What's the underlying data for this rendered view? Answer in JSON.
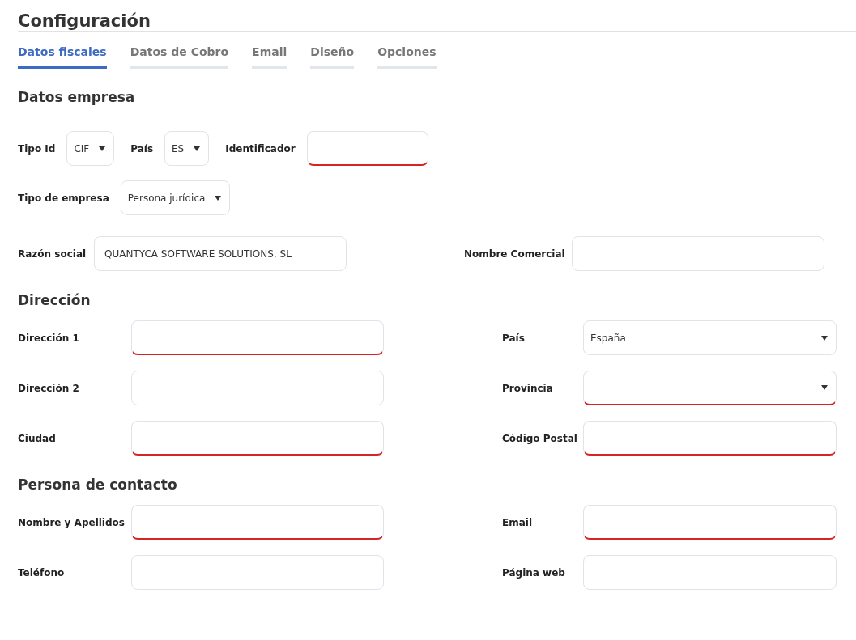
{
  "title": "Configuración",
  "tabs": [
    {
      "label": "Datos fiscales",
      "selected": true
    },
    {
      "label": "Datos de Cobro",
      "selected": false
    },
    {
      "label": "Email",
      "selected": false
    },
    {
      "label": "Diseño",
      "selected": false
    },
    {
      "label": "Opciones",
      "selected": false
    }
  ],
  "sections": [
    {
      "heading": "Datos empresa",
      "rows": [
        {
          "kind": "inline",
          "fields": [
            {
              "label": "Tipo Id",
              "kind": "select",
              "value": "CIF",
              "invalid": false
            },
            {
              "label": "País",
              "kind": "select",
              "value": "ES",
              "invalid": false
            },
            {
              "label": "Identificador",
              "kind": "input",
              "invalid": true
            }
          ]
        },
        {
          "kind": "inline",
          "fields": [
            {
              "label": "Tipo de empresa",
              "kind": "select",
              "value": "Persona jurídica",
              "invalid": false
            }
          ]
        },
        {
          "kind": "pair-compact",
          "fields": [
            {
              "label": "Razón social",
              "kind": "input",
              "value": "QUANTYCA SOFTWARE SOLUTIONS, SL",
              "invalid": false
            },
            {
              "label": "Nombre Comercial",
              "kind": "input",
              "invalid": false
            }
          ]
        }
      ]
    },
    {
      "heading": "Dirección",
      "rows": [
        {
          "kind": "pair",
          "fields": [
            {
              "label": "Dirección 1",
              "kind": "input",
              "invalid": true
            },
            {
              "label": "País",
              "kind": "select",
              "value": "España",
              "invalid": false
            }
          ]
        },
        {
          "kind": "pair",
          "fields": [
            {
              "label": "Dirección 2",
              "kind": "input",
              "invalid": false
            },
            {
              "label": "Provincia",
              "kind": "select",
              "invalid": true
            }
          ]
        },
        {
          "kind": "pair",
          "fields": [
            {
              "label": "Ciudad",
              "kind": "input",
              "invalid": true
            },
            {
              "label": "Código Postal",
              "kind": "input",
              "invalid": true
            }
          ]
        }
      ]
    },
    {
      "heading": "Persona de contacto",
      "rows": [
        {
          "kind": "pair",
          "fields": [
            {
              "label": "Nombre y Apellidos",
              "kind": "input",
              "invalid": true
            },
            {
              "label": "Email",
              "kind": "input",
              "invalid": true
            }
          ]
        },
        {
          "kind": "pair",
          "fields": [
            {
              "label": "Teléfono",
              "kind": "input",
              "invalid": false
            },
            {
              "label": "Página web",
              "kind": "input",
              "invalid": false
            }
          ]
        }
      ]
    }
  ]
}
